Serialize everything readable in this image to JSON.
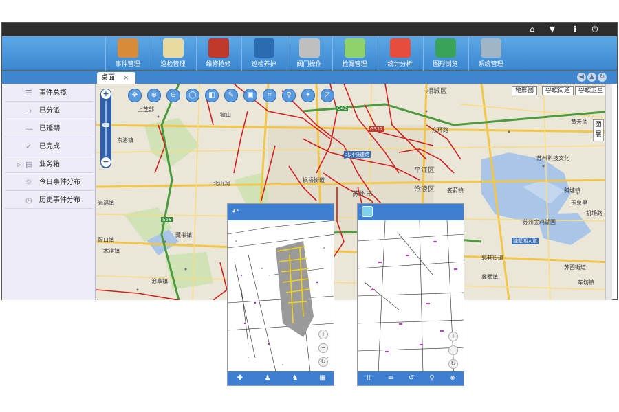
{
  "toolbar": {
    "items": [
      {
        "label": "事件管理",
        "icon": "clipboard-warning-icon",
        "color": "#d98a3a"
      },
      {
        "label": "巡检管理",
        "icon": "notepad-icon",
        "color": "#e9d9a0"
      },
      {
        "label": "维修抢修",
        "icon": "repair-worker-icon",
        "color": "#c0392b"
      },
      {
        "label": "巡检养护",
        "icon": "maintenance-phone-icon",
        "color": "#2b6cb0"
      },
      {
        "label": "阀门操作",
        "icon": "valve-icon",
        "color": "#bfbfbf"
      },
      {
        "label": "检漏管理",
        "icon": "leak-detect-icon",
        "color": "#8fd16a"
      },
      {
        "label": "统计分析",
        "icon": "pie-chart-icon",
        "color": "#e74c3c"
      },
      {
        "label": "图形浏览",
        "icon": "globe-search-icon",
        "color": "#3aa35a"
      },
      {
        "label": "系统管理",
        "icon": "gear-icon",
        "color": "#9fb6c9"
      }
    ]
  },
  "tab": {
    "label": "桌面",
    "close": "×"
  },
  "sidebar": {
    "items": [
      {
        "label": "事件总揽",
        "icon": "list-icon"
      },
      {
        "label": "已分派",
        "icon": "arrow-right-icon"
      },
      {
        "label": "已延期",
        "icon": "dash-icon"
      },
      {
        "label": "已完成",
        "icon": "check-icon"
      },
      {
        "label": "业务箱",
        "icon": "box-icon"
      },
      {
        "label": "今日事件分布",
        "icon": "sun-icon"
      },
      {
        "label": "历史事件分布",
        "icon": "clock-icon"
      }
    ]
  },
  "map": {
    "types": [
      "地形图",
      "谷歌街道",
      "谷歌卫星"
    ],
    "layer_label": "图层",
    "labels": [
      {
        "text": "相城区"
      },
      {
        "text": "苏州市"
      },
      {
        "text": "平江区"
      },
      {
        "text": "沧浪区"
      },
      {
        "text": "金阊区"
      },
      {
        "text": "上芝部"
      },
      {
        "text": "东渚镇"
      },
      {
        "text": "光福镇"
      },
      {
        "text": "胥口镇"
      },
      {
        "text": "枫桥街道"
      },
      {
        "text": "娄葑镇"
      },
      {
        "text": "斜塘镇"
      },
      {
        "text": "郭巷街道"
      },
      {
        "text": "车坊镇"
      },
      {
        "text": "苏州科技文化"
      },
      {
        "text": "玉泉里"
      },
      {
        "text": "机场路"
      },
      {
        "text": "苏州金鸡湖国"
      },
      {
        "text": "獐山"
      },
      {
        "text": "藏书镇"
      },
      {
        "text": "木渎镇"
      },
      {
        "text": "北山洞"
      },
      {
        "text": "沧阜镇"
      },
      {
        "text": "蠡墅镇"
      },
      {
        "text": "苏西街道"
      },
      {
        "text": "东环路"
      },
      {
        "text": "G312"
      },
      {
        "text": "G42"
      },
      {
        "text": "S58"
      },
      {
        "text": "独墅湖大道"
      },
      {
        "text": "北环快速路"
      },
      {
        "text": "黄天荡"
      }
    ]
  },
  "phones": {
    "left_back": "↶",
    "right_app_icon": "map-app-icon"
  }
}
